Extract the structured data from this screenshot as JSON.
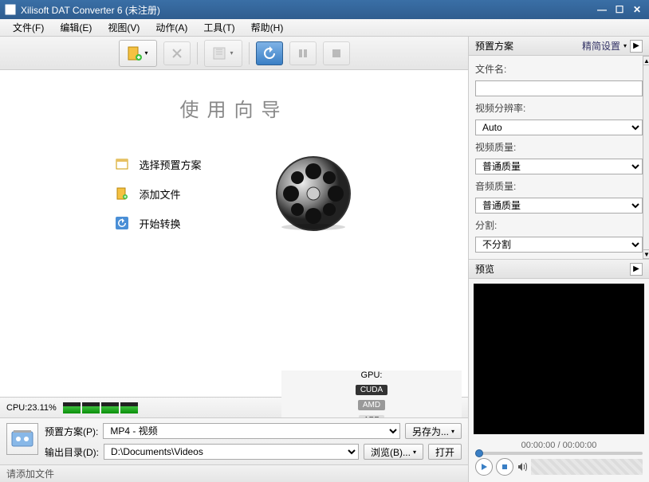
{
  "title": "Xilisoft DAT Converter 6 (未注册)",
  "menu": [
    "文件(F)",
    "编辑(E)",
    "视图(V)",
    "动作(A)",
    "工具(T)",
    "帮助(H)"
  ],
  "wizard": {
    "title": "使用向导",
    "steps": [
      "选择预置方案",
      "添加文件",
      "开始转换"
    ]
  },
  "cpu": {
    "label": "CPU:",
    "value": "23.11%"
  },
  "gpu": {
    "label": "GPU:",
    "cuda": "CUDA",
    "amd": "AMD",
    "app": "APP"
  },
  "profile": {
    "scheme_lbl": "预置方案(P):",
    "scheme_val": "MP4 - 视频",
    "saveas": "另存为...",
    "outdir_lbl": "输出目录(D):",
    "outdir_val": "D:\\Documents\\Videos",
    "browse": "浏览(B)...",
    "open": "打开"
  },
  "status": "请添加文件",
  "rpanel": {
    "hdr": "预置方案",
    "advlink": "精简设置",
    "filename": "文件名:",
    "res_lbl": "视频分辨率:",
    "res_val": "Auto",
    "vq_lbl": "视频质量:",
    "vq_val": "普通质量",
    "aq_lbl": "音频质量:",
    "aq_val": "普通质量",
    "split_lbl": "分割:",
    "split_val": "不分割"
  },
  "preview": {
    "hdr": "预览",
    "time": "00:00:00 / 00:00:00"
  }
}
